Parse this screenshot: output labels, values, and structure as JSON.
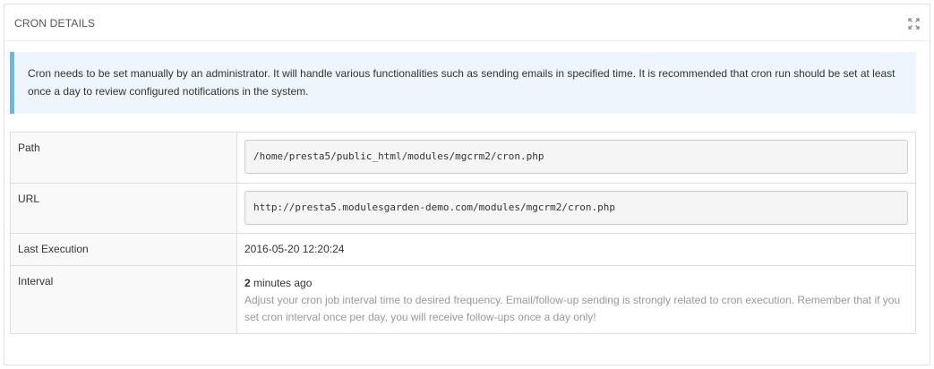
{
  "panel": {
    "title": "CRON DETAILS",
    "expand_icon": "expand-arrows-icon"
  },
  "alert": {
    "text": "Cron needs to be set manually by an administrator. It will handle various functionalities such as sending emails in specified time. It is recommended that cron run should be set at least once a day to review configured notifications in the system.",
    "accent_color": "#5bc0de",
    "background_color": "#eef5fc"
  },
  "details": {
    "path": {
      "label": "Path",
      "value": "/home/presta5/public_html/modules/mgcrm2/cron.php"
    },
    "url": {
      "label": "URL",
      "value": "http://presta5.modulesgarden-demo.com/modules/mgcrm2/cron.php"
    },
    "last_execution": {
      "label": "Last Execution",
      "value": "2016-05-20 12:20:24"
    },
    "interval": {
      "label": "Interval",
      "number": "2",
      "unit": " minutes ago",
      "help": "Adjust your cron job interval time to desired frequency. Email/follow-up sending is strongly related to cron execution. Remember that if you set cron interval once per day, you will receive follow-ups once a day only!"
    }
  }
}
